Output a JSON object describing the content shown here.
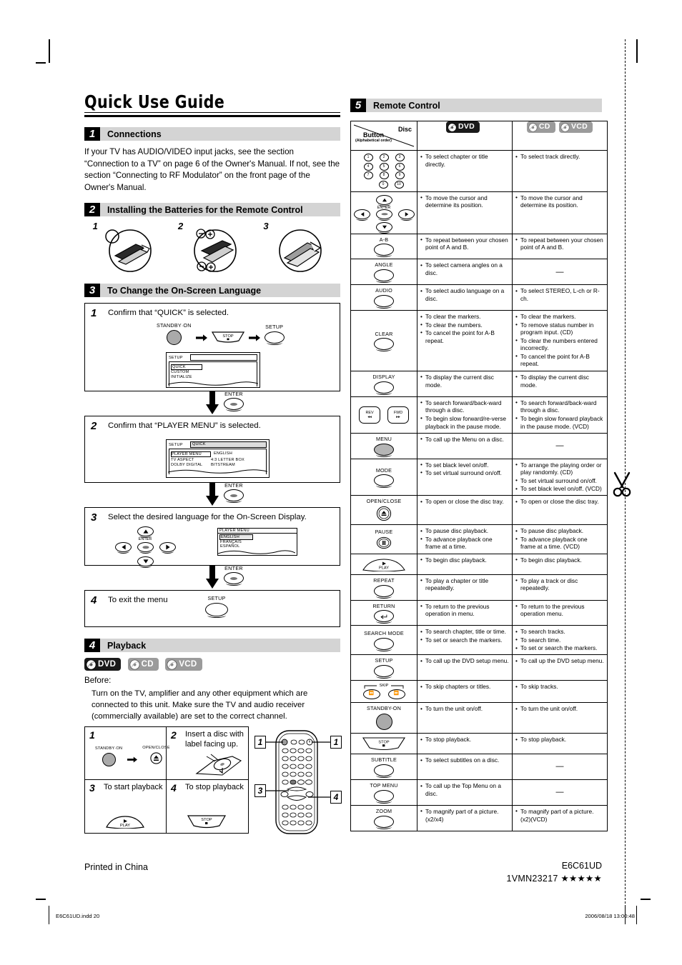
{
  "page": {
    "title": "Quick Use Guide",
    "printed_in": "Printed in China",
    "model_code": "E6C61UD",
    "part_number": "1VMN23217 ★★★★★",
    "footer_file": "E6C61UD.indd   20",
    "footer_date": "2006/08/18   13:00:48"
  },
  "sections": {
    "s1": {
      "num": "1",
      "title": "Connections",
      "body": "If your TV has AUDIO/VIDEO input jacks, see the section “Connection to a TV” on page 6 of the Owner's Manual. If not, see the section “Connecting to RF Modulator” on the front page of the Owner's Manual."
    },
    "s2": {
      "num": "2",
      "title": "Installing the Batteries for the Remote Control",
      "figures": [
        "1",
        "2",
        "3"
      ]
    },
    "s3": {
      "num": "3",
      "title": "To Change the On-Screen Language",
      "steps": [
        {
          "num": "1",
          "text": "Confirm that “QUICK” is selected.",
          "buttons": [
            "STANDBY·ON",
            "STOP",
            "SETUP"
          ],
          "osd": {
            "header_label": "SETUP",
            "header_value": "",
            "rows": [
              "QUICK",
              "CUSTOM",
              "INITIALIZE"
            ],
            "selected": "QUICK"
          }
        },
        {
          "num": "2",
          "text": "Confirm that “PLAYER MENU” is selected.",
          "osd": {
            "header_label": "SETUP",
            "header_value": "QUICK",
            "rows": [
              {
                "k": "PLAYER MENU",
                "v": "ENGLISH"
              },
              {
                "k": "TV ASPECT",
                "v": "4:3 LETTER BOX"
              },
              {
                "k": "DOLBY DIGITAL",
                "v": "BITSTREAM"
              }
            ],
            "selected": "PLAYER MENU"
          }
        },
        {
          "num": "3",
          "text": "Select the desired language for the On-Screen Display.",
          "enter_label": "ENTER",
          "osd": {
            "title": "PLAYER MENU",
            "rows": [
              "ENGLISH",
              "FRANÇAIS",
              "ESPAÑOL"
            ],
            "selected": "ENGLISH"
          }
        },
        {
          "num": "4",
          "text": "To exit the menu",
          "button": "SETUP"
        }
      ],
      "arrow_labels": [
        "ENTER",
        "ENTER",
        "ENTER"
      ]
    },
    "s4": {
      "num": "4",
      "title": "Playback",
      "badges": [
        "DVD",
        "CD",
        "VCD"
      ],
      "before_label": "Before:",
      "before_text": "Turn on the TV, amplifier and any other equipment which are connected to this unit. Make sure the TV and audio receiver (commercially available) are set to the correct channel.",
      "cells": [
        {
          "num": "1",
          "text": "",
          "btn_labels": [
            "STANDBY·ON",
            "OPEN/CLOSE"
          ]
        },
        {
          "num": "2",
          "text": "Insert a disc with label facing up."
        },
        {
          "num": "3",
          "text": "To start playback",
          "button": "PLAY"
        },
        {
          "num": "4",
          "text": "To stop playback",
          "button": "STOP"
        }
      ],
      "callouts": [
        "1",
        "1",
        "3",
        "4"
      ]
    },
    "s5": {
      "num": "5",
      "title": "Remote Control"
    }
  },
  "remote_table": {
    "header": {
      "disc": "Disc",
      "button": "Button",
      "button_sub": "(Alphabetical order)",
      "dvd": "DVD",
      "cd": "CD",
      "vcd": "VCD"
    },
    "dash": "—",
    "rows": [
      {
        "button": "numbers",
        "button_label": "",
        "dvd": [
          "To select chapter or title directly."
        ],
        "cd": [
          "To select track directly."
        ]
      },
      {
        "button": "dpad",
        "button_label": "ENTER",
        "dvd": [
          "To move the cursor and determine its position."
        ],
        "cd": [
          "To move the cursor and determine its position."
        ]
      },
      {
        "button": "oval",
        "button_label": "A-B",
        "dvd": [
          "To repeat between your chosen point of A and B."
        ],
        "cd": [
          "To repeat between your chosen point of A and B."
        ]
      },
      {
        "button": "oval",
        "button_label": "ANGLE",
        "dvd": [
          "To select camera angles on a disc."
        ],
        "cd": null
      },
      {
        "button": "oval",
        "button_label": "AUDIO",
        "dvd": [
          "To select audio language on a disc."
        ],
        "cd": [
          "To select STEREO, L-ch or R-ch."
        ]
      },
      {
        "button": "oval",
        "button_label": "CLEAR",
        "dvd": [
          "To clear the markers.",
          "To clear the numbers.",
          "To cancel the point for A-B repeat."
        ],
        "cd": [
          "To clear the markers.",
          "To remove status number in program input. (CD)",
          "To clear the numbers entered incorrectly.",
          "To cancel the point for A-B repeat."
        ]
      },
      {
        "button": "oval",
        "button_label": "DISPLAY",
        "dvd": [
          "To display the current disc mode."
        ],
        "cd": [
          "To display the current disc mode."
        ]
      },
      {
        "button": "revfwd",
        "button_label": "REV FWD",
        "dvd": [
          "To search forward/back-ward through a disc.",
          "To begin slow forward/re-verse playback in the pause mode."
        ],
        "cd": [
          "To search forward/back-ward through a disc.",
          "To begin slow forward playback in the pause mode. (VCD)"
        ]
      },
      {
        "button": "oval-filled",
        "button_label": "MENU",
        "dvd": [
          "To call up the Menu on a disc."
        ],
        "cd": null
      },
      {
        "button": "oval",
        "button_label": "MODE",
        "dvd": [
          "To set black level on/off.",
          "To set virtual surround on/off."
        ],
        "cd": [
          "To arrange the playing order or play randomly. (CD)",
          "To set virtual surround on/off.",
          "To set black level on/off. (VCD)"
        ]
      },
      {
        "button": "circle-eject",
        "button_label": "OPEN/CLOSE",
        "dvd": [
          "To open or close the disc tray."
        ],
        "cd": [
          "To open or close the disc tray."
        ]
      },
      {
        "button": "circle-pause",
        "button_label": "PAUSE",
        "dvd": [
          "To pause disc playback.",
          "To advance playback one frame at a time."
        ],
        "cd": [
          "To pause disc playback.",
          "To advance playback one frame at a time. (VCD)"
        ]
      },
      {
        "button": "play-trapezoid",
        "button_label": "PLAY",
        "dvd": [
          "To begin disc playback."
        ],
        "cd": [
          "To begin disc playback."
        ]
      },
      {
        "button": "oval",
        "button_label": "REPEAT",
        "dvd": [
          "To play a chapter or title repeatedly."
        ],
        "cd": [
          "To play a track or disc repeatedly."
        ]
      },
      {
        "button": "oval-return",
        "button_label": "RETURN",
        "dvd": [
          "To return to the previous operation in menu."
        ],
        "cd": [
          "To return to the previous operation menu."
        ]
      },
      {
        "button": "oval",
        "button_label": "SEARCH MODE",
        "dvd": [
          "To search chapter, title or time.",
          "To set or search the markers."
        ],
        "cd": [
          "To search tracks.",
          "To search time.",
          "To set or search the markers."
        ]
      },
      {
        "button": "oval",
        "button_label": "SETUP",
        "dvd": [
          "To call up the DVD setup menu."
        ],
        "cd": [
          "To call up the DVD setup menu."
        ]
      },
      {
        "button": "skip",
        "button_label": "SKIP",
        "dvd": [
          "To skip chapters or titles."
        ],
        "cd": [
          "To skip tracks."
        ]
      },
      {
        "button": "circle-grey",
        "button_label": "STANDBY-ON",
        "dvd": [
          "To turn the unit on/off."
        ],
        "cd": [
          "To turn the unit on/off."
        ]
      },
      {
        "button": "stop-trapezoid",
        "button_label": "STOP",
        "dvd": [
          "To stop playback."
        ],
        "cd": [
          "To stop playback."
        ]
      },
      {
        "button": "oval",
        "button_label": "SUBTITLE",
        "dvd": [
          "To select subtitles on a disc."
        ],
        "cd": null
      },
      {
        "button": "oval",
        "button_label": "TOP MENU",
        "dvd": [
          "To call up the Top Menu on a disc."
        ],
        "cd": null
      },
      {
        "button": "oval",
        "button_label": "ZOOM",
        "dvd": [
          "To magnify part of a picture. (x2/x4)"
        ],
        "cd": [
          "To magnify part of a picture. (x2)(VCD)"
        ]
      }
    ]
  },
  "colors": {
    "section_bar": "#d4d4d4",
    "section_num": "#000000",
    "badge_dvd": "#1a1a1a",
    "badge_cd": "#9b9b9b",
    "standby_button": "#aaaaaa"
  }
}
